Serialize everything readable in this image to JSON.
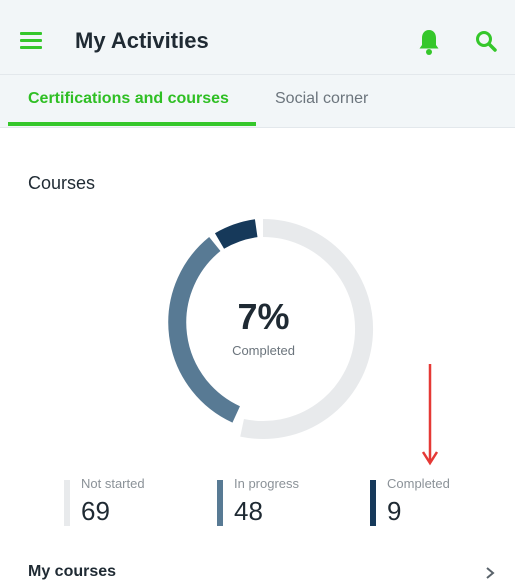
{
  "appbar": {
    "title": "My Activities",
    "accent_color": "#35c72b",
    "icons": [
      "menu-icon",
      "bell-icon",
      "search-icon"
    ]
  },
  "tabs": [
    {
      "label": "Certifications and courses",
      "active": true
    },
    {
      "label": "Social corner",
      "active": false
    }
  ],
  "courses": {
    "section_title": "Courses",
    "completion_percent": "7%",
    "completion_label": "Completed",
    "stats": [
      {
        "label": "Not started",
        "value": "69",
        "color": "#e8eaec"
      },
      {
        "label": "In progress",
        "value": "48",
        "color": "#587a94"
      },
      {
        "label": "Completed",
        "value": "9",
        "color": "#16395a"
      }
    ]
  },
  "my_courses": {
    "label": "My courses",
    "icon": "chevron-right-icon"
  },
  "annotation": {
    "icon": "red-down-arrow",
    "color": "#e53935"
  }
}
